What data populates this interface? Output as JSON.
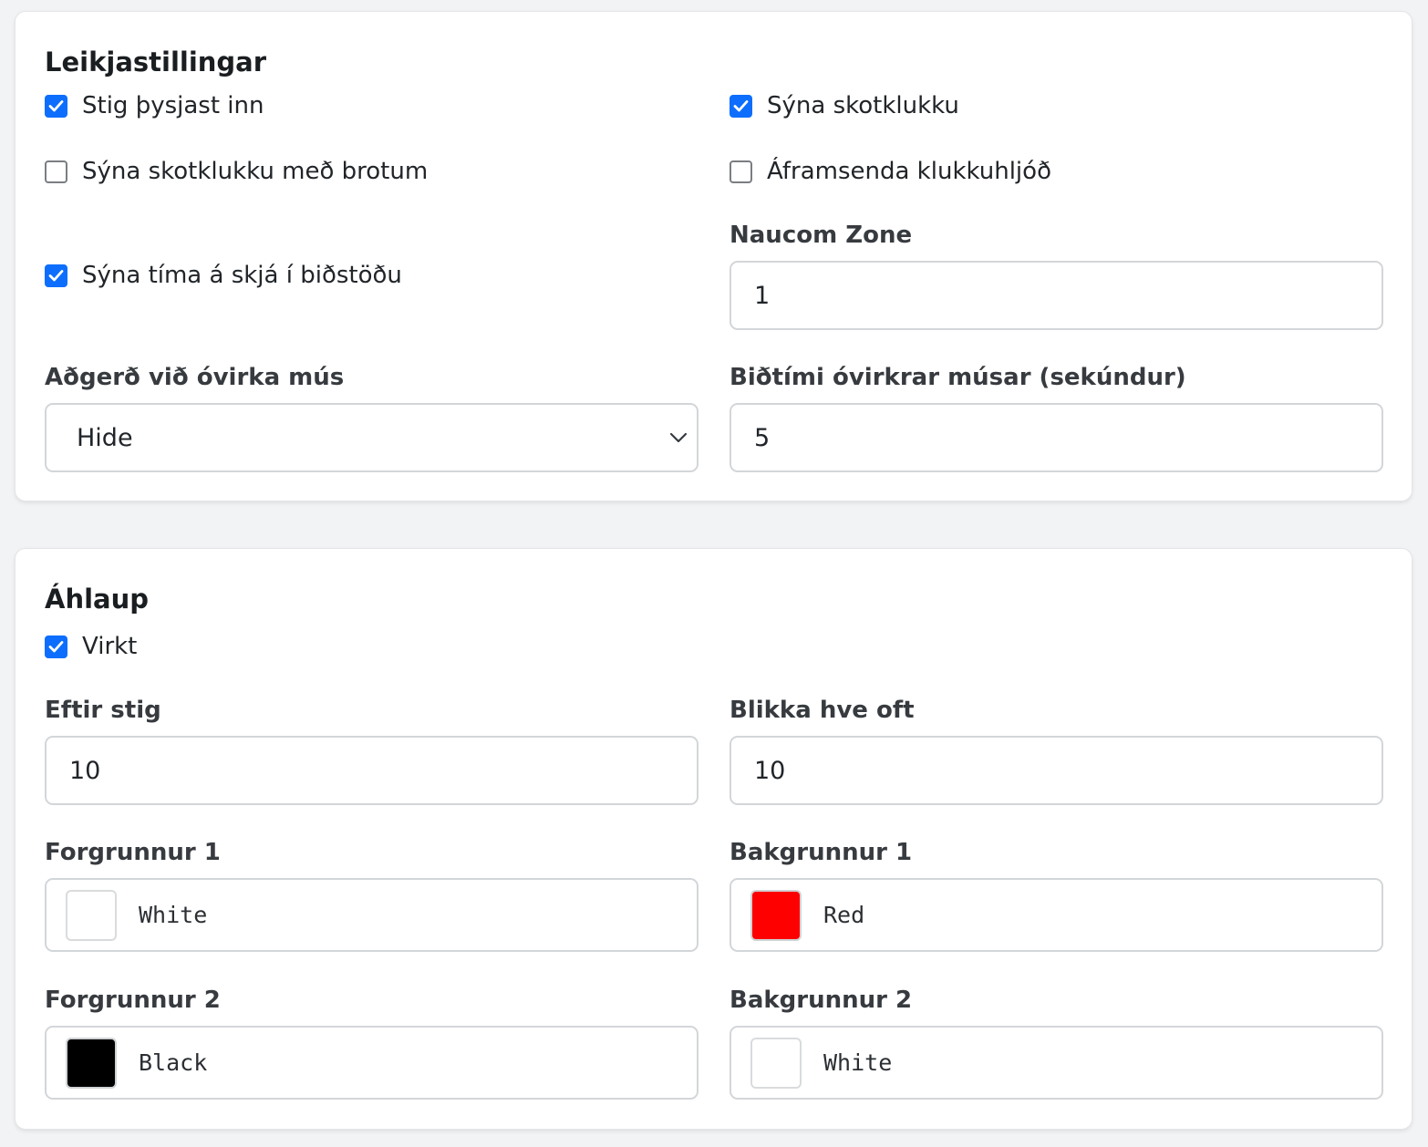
{
  "game_settings": {
    "title": "Leikjastillingar",
    "checkboxes": {
      "scores_stack": {
        "label": "Stig þysjast inn",
        "checked": true
      },
      "show_shot_clock": {
        "label": "Sýna skotklukku",
        "checked": true
      },
      "show_shot_clock_fractions": {
        "label": "Sýna skotklukku með brotum",
        "checked": false
      },
      "forward_clock_sound": {
        "label": "Áframsenda klukkuhljóð",
        "checked": false
      },
      "show_time_idle": {
        "label": "Sýna tíma á skjá í biðstöðu",
        "checked": true
      }
    },
    "naucom_zone": {
      "label": "Naucom Zone",
      "value": "1"
    },
    "idle_mouse_action": {
      "label": "Aðgerð við óvirka mús",
      "value": "Hide"
    },
    "idle_mouse_timeout": {
      "label": "Biðtími óvirkrar músar (sekúndur)",
      "value": "5"
    }
  },
  "attack": {
    "title": "Áhlaup",
    "enabled": {
      "label": "Virkt",
      "checked": true
    },
    "after_points": {
      "label": "Eftir stig",
      "value": "10"
    },
    "blink_frequency": {
      "label": "Blikka hve oft",
      "value": "10"
    },
    "foreground_1": {
      "label": "Forgrunnur 1",
      "color_name": "White",
      "color": "#ffffff"
    },
    "background_1": {
      "label": "Bakgrunnur 1",
      "color_name": "Red",
      "color": "#ff0000"
    },
    "foreground_2": {
      "label": "Forgrunnur 2",
      "color_name": "Black",
      "color": "#000000"
    },
    "background_2": {
      "label": "Bakgrunnur 2",
      "color_name": "White",
      "color": "#ffffff"
    }
  }
}
